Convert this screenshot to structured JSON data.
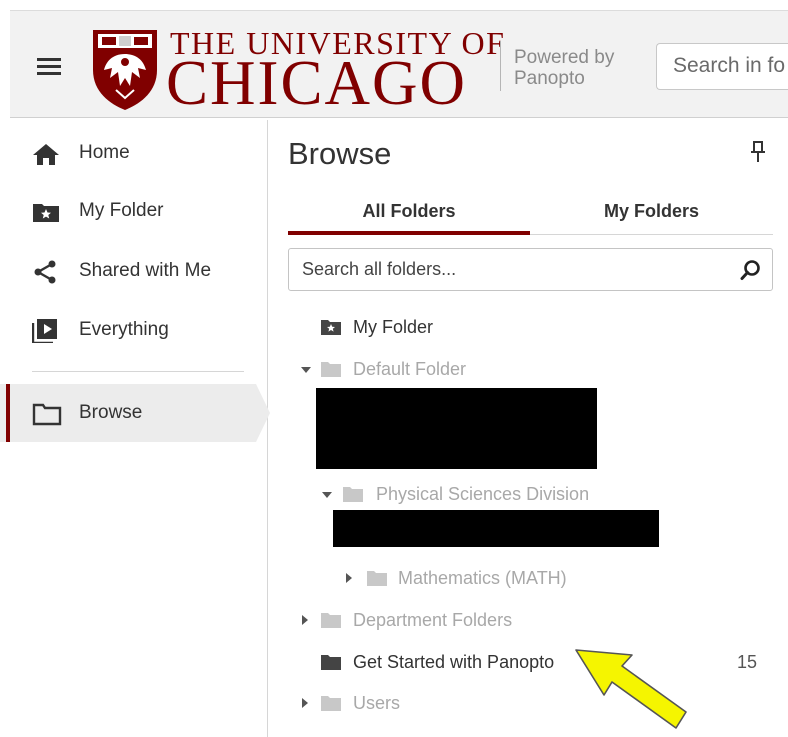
{
  "header": {
    "logo_line1": "THE UNIVERSITY OF",
    "logo_line2": "CHICAGO",
    "powered_line1": "Powered by",
    "powered_line2": "Panopto",
    "search_placeholder": "Search in fo",
    "brand_color": "#800000"
  },
  "sidebar": {
    "items": [
      {
        "label": "Home",
        "icon": "home-icon"
      },
      {
        "label": "My Folder",
        "icon": "starred-folder-icon"
      },
      {
        "label": "Shared with Me",
        "icon": "share-icon"
      },
      {
        "label": "Everything",
        "icon": "play-stack-icon"
      },
      {
        "label": "Browse",
        "icon": "folder-outline-icon",
        "active": true
      }
    ]
  },
  "browse": {
    "title": "Browse",
    "tabs": [
      {
        "label": "All Folders",
        "active": true
      },
      {
        "label": "My Folders",
        "active": false
      }
    ],
    "search_placeholder": "Search all folders...",
    "tree": [
      {
        "label": "My Folder",
        "icon": "starred-folder-icon"
      },
      {
        "label": "Default Folder",
        "expanded": true
      },
      {
        "label": "Physical Sciences Division",
        "expanded": true
      },
      {
        "label": "Mathematics (MATH)",
        "expanded": false
      },
      {
        "label": "Department Folders",
        "expanded": false
      },
      {
        "label": "Get Started with Panopto",
        "count": "15"
      },
      {
        "label": "Users",
        "expanded": false
      }
    ]
  },
  "annotation": {
    "arrow_color": "#f5f500"
  }
}
